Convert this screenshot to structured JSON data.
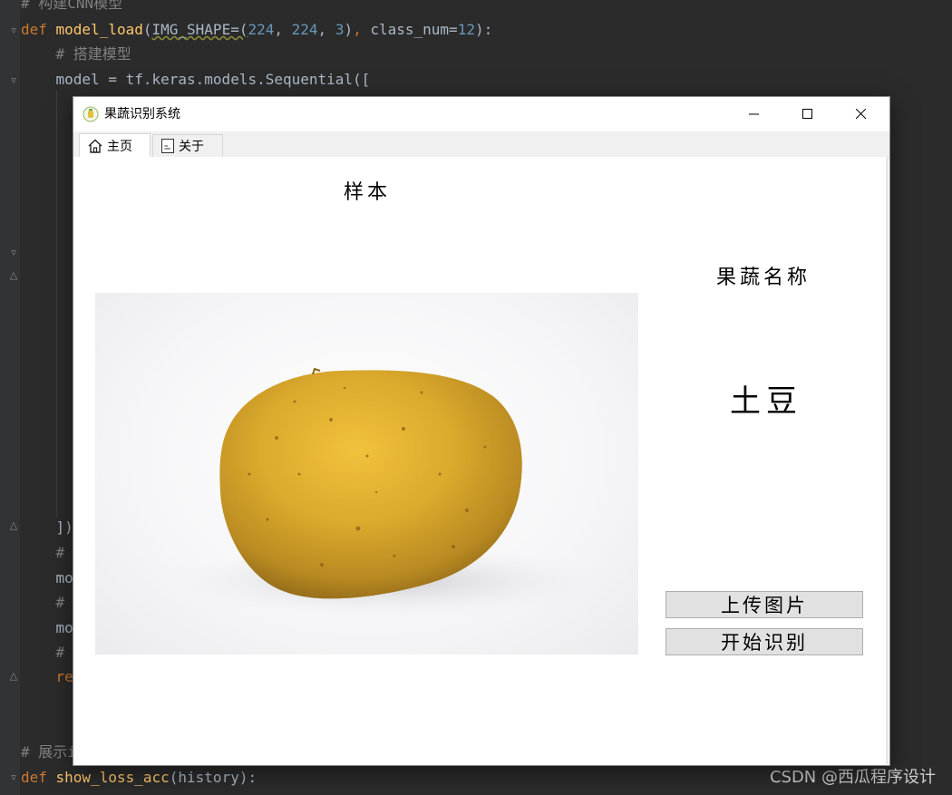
{
  "window": {
    "title": "果蔬识别系统",
    "tabs": [
      {
        "label": "主页",
        "icon": "home-icon",
        "active": true
      },
      {
        "label": "关于",
        "icon": "document-icon",
        "active": false
      }
    ]
  },
  "main": {
    "sample_label": "样本",
    "name_label": "果蔬名称",
    "result_text": "土豆",
    "upload_button": "上传图片",
    "start_button": "开始识别"
  },
  "ide": {
    "lines": [
      {
        "parts": [
          [
            "cmt",
            "# 构建CNN模型"
          ]
        ]
      },
      {
        "parts": [
          [
            "kw",
            "def "
          ],
          [
            "fn",
            "model_load"
          ],
          [
            "",
            "("
          ],
          [
            "u",
            "IMG_SHAPE=("
          ],
          [
            "num",
            "224"
          ],
          [
            "",
            ", "
          ],
          [
            "num",
            "224"
          ],
          [
            "",
            ", "
          ],
          [
            "num",
            "3"
          ],
          [
            "",
            ")"
          ],
          [
            "kw",
            ", "
          ],
          [
            "",
            "class_num="
          ],
          [
            "num",
            "12"
          ],
          [
            "",
            "):"
          ]
        ]
      },
      {
        "parts": [
          [
            "cmt",
            "    # 搭建模型"
          ]
        ]
      },
      {
        "parts": [
          [
            "",
            "    model = tf.keras.models.Sequential(["
          ]
        ]
      },
      {
        "parts": [
          [
            "",
            "    ])"
          ]
        ]
      },
      {
        "parts": [
          [
            "cmt",
            "    #"
          ]
        ]
      },
      {
        "parts": [
          [
            "",
            "    mo"
          ]
        ]
      },
      {
        "parts": [
          [
            "cmt",
            "    #"
          ]
        ]
      },
      {
        "parts": [
          [
            "",
            "    mo"
          ]
        ]
      },
      {
        "parts": [
          [
            "cmt",
            "    #"
          ]
        ]
      },
      {
        "parts": [
          [
            "kw",
            "    re"
          ]
        ]
      },
      {
        "parts": [
          [
            "cmt",
            "# 展示i"
          ]
        ]
      },
      {
        "parts": [
          [
            "kw",
            "def "
          ],
          [
            "fn",
            "show_loss_acc"
          ],
          [
            "",
            "(history):"
          ]
        ]
      }
    ]
  },
  "watermark": "CSDN @西瓜程序设计",
  "colors": {
    "ide_bg": "#2b2b2b",
    "keyword": "#cc7832",
    "function": "#ffc66d",
    "number": "#6897bb",
    "comment": "#808080",
    "button_bg": "#e1e1e1"
  }
}
